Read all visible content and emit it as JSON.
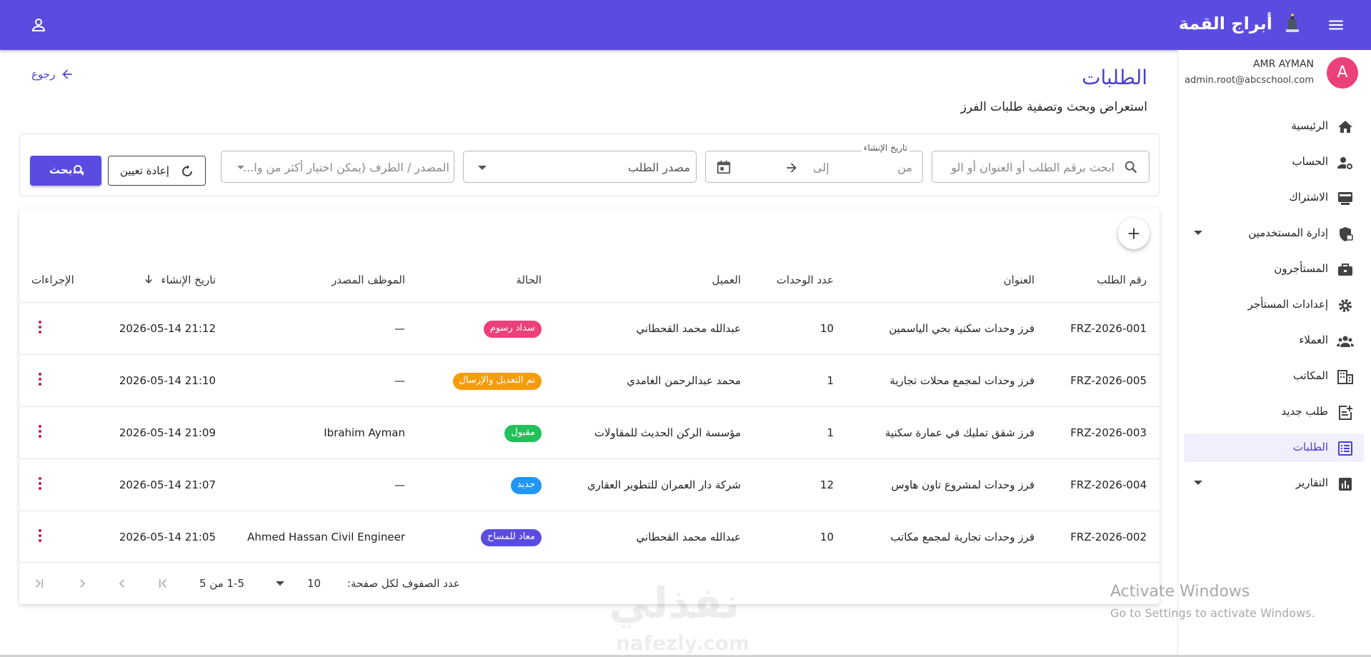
{
  "header": {
    "app_title": "أبراج القمة",
    "brand_color": "#5b4ce1"
  },
  "user": {
    "initial": "A",
    "name": "AMR AYMAN",
    "email": "admin.root@abcschool.com"
  },
  "sidebar": {
    "items": [
      {
        "label": "الرئيسية",
        "icon": "home-icon"
      },
      {
        "label": "الحساب",
        "icon": "account-gear-icon"
      },
      {
        "label": "الاشتراك",
        "icon": "subscription-icon"
      },
      {
        "label": "إدارة المستخدمين",
        "icon": "shield-lock-icon"
      },
      {
        "label": "المستأجرون",
        "icon": "briefcase-icon"
      },
      {
        "label": "إعدادات المستأجر",
        "icon": "gear-icon"
      },
      {
        "label": "العملاء",
        "icon": "people-icon"
      },
      {
        "label": "المكاتب",
        "icon": "building-icon"
      },
      {
        "label": "طلب جديد",
        "icon": "add-note-icon"
      },
      {
        "label": "الطلبات",
        "icon": "list-icon"
      },
      {
        "label": "التقارير",
        "icon": "chart-icon"
      }
    ]
  },
  "page": {
    "title": "الطلبات",
    "subtitle": "استعراض وبحث وتصفية طلبات الفرز",
    "back_label": "رجوع"
  },
  "filters": {
    "search_placeholder": "ابحث برقم الطلب أو العنوان أو الو",
    "date_legend": "تاريخ الإنشاء",
    "date_from": "من",
    "date_to": "إلى",
    "source_placeholder": "مصدر الطلب",
    "party_placeholder": "المصدر / الطرف (يمكن اختيار أكثر من وا...",
    "reset_label": "إعادة تعيين",
    "search_label": "بحث..."
  },
  "table": {
    "columns": {
      "request_no": "رقم الطلب",
      "title": "العنوان",
      "units": "عدد الوحدات",
      "client": "العميل",
      "status": "الحالة",
      "employee": "الموظف المصدر",
      "created": "تاريخ الإنشاء",
      "actions": "الإجراءات"
    },
    "rows": [
      {
        "request_no": "FRZ-2026-001",
        "title": "فرز وحدات سكنية بحي الياسمين",
        "units": "10",
        "client": "عبدالله محمد القحطاني",
        "status": "سداد رسوم",
        "status_color": "#ec407a",
        "employee": "—",
        "created": "2026-05-14 21:12"
      },
      {
        "request_no": "FRZ-2026-005",
        "title": "فرز وحدات لمجمع محلات تجارية",
        "units": "1",
        "client": "محمد عبدالرحمن الغامدي",
        "status": "تم التعديل والإرسال",
        "status_color": "#f59c0b",
        "employee": "—",
        "created": "2026-05-14 21:10"
      },
      {
        "request_no": "FRZ-2026-003",
        "title": "فرز شقق تمليك في عمارة سكنية",
        "units": "1",
        "client": "مؤسسة الركن الحديث للمقاولات",
        "status": "مقبول",
        "status_color": "#21c05a",
        "employee": "Ibrahim Ayman",
        "created": "2026-05-14 21:09"
      },
      {
        "request_no": "FRZ-2026-004",
        "title": "فرز وحدات لمشروع تاون هاوس",
        "units": "12",
        "client": "شركة دار العمران للتطوير العقاري",
        "status": "جديد",
        "status_color": "#2196f3",
        "employee": "—",
        "created": "2026-05-14 21:07"
      },
      {
        "request_no": "FRZ-2026-002",
        "title": "فرز وحدات تجارية لمجمع مكاتب",
        "units": "10",
        "client": "عبدالله محمد القحطاني",
        "status": "معاد للمساح",
        "status_color": "#5b4ce1",
        "employee": "Ahmed Hassan Civil Engineer",
        "created": "2026-05-14 21:05"
      }
    ],
    "footer": {
      "rows_per_page_label": "عدد الصفوف لكل صفحة:",
      "rows_per_page_value": "10",
      "range": "1-5 من 5"
    }
  },
  "watermark": {
    "activate_title": "Activate Windows",
    "activate_sub": "Go to Settings to activate Windows.",
    "brand_ar": "نفذلي",
    "brand_en": "nafezly.com"
  }
}
